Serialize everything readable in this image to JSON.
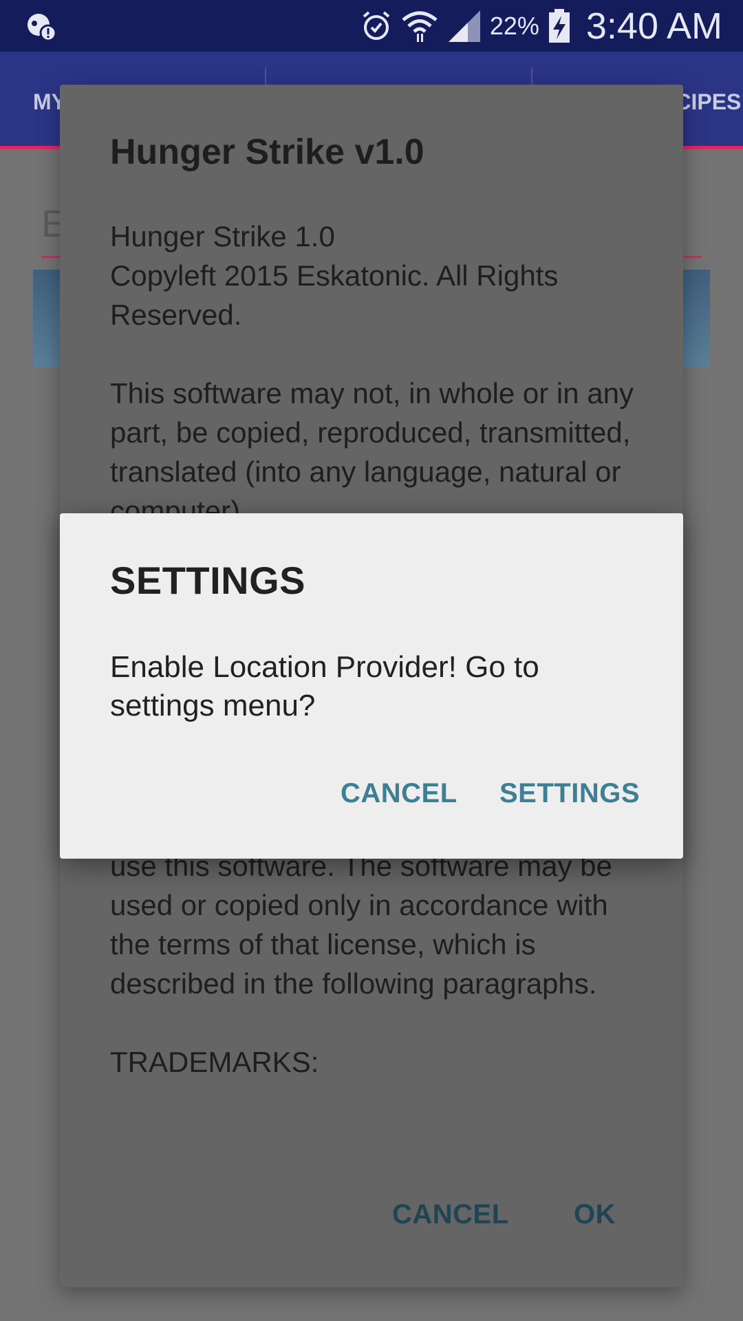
{
  "status_bar": {
    "icons": [
      "notification-alert-icon",
      "alarm-icon",
      "wifi-icon",
      "signal-icon",
      "battery-charging-icon"
    ],
    "battery": "22%",
    "time": "3:40 AM"
  },
  "app_bar": {
    "tab_left_partial": "MY",
    "tab_right_partial": "ECIPES"
  },
  "background": {
    "input_partial": "E"
  },
  "about_dialog": {
    "title": "Hunger Strike v1.0",
    "body_top": "Hunger Strike 1.0\nCopyleft 2015 Eskatonic. All Rights Reserved.\n\nThis software may not, in whole or in any part, be copied, reproduced, transmitted, translated (into any language, natural or computer)",
    "body_bottom": "use this software. The software may be used or copied only in accordance with the terms of that license, which is described in the following paragraphs.\n\nTRADEMARKS:",
    "cancel_label": "CANCEL",
    "ok_label": "OK"
  },
  "settings_dialog": {
    "title": "SETTINGS",
    "message": "Enable Location Provider! Go to settings menu?",
    "cancel_label": "CANCEL",
    "settings_label": "SETTINGS"
  },
  "colors": {
    "status_bar": "#141c5c",
    "app_bar": "#2b3586",
    "accent": "#e02765",
    "dialog_button": "#3e7f93"
  }
}
